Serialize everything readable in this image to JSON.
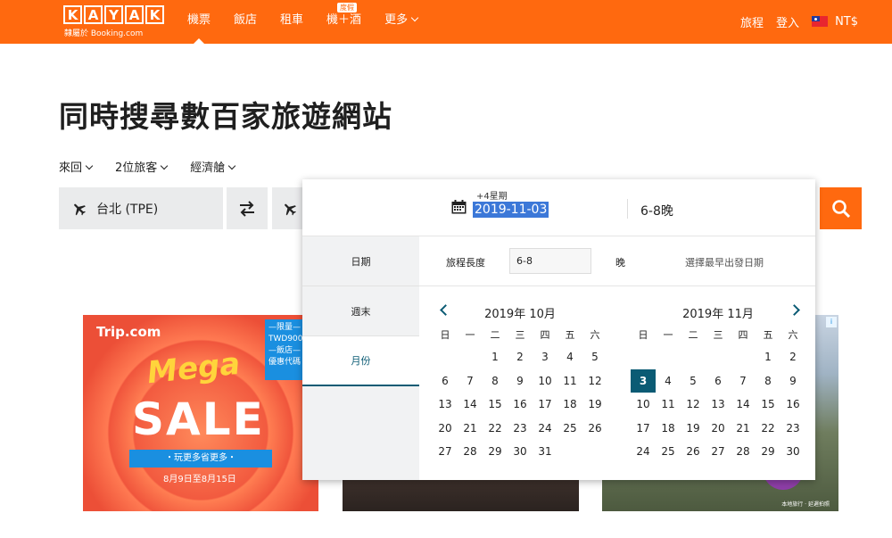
{
  "header": {
    "logo_letters": [
      "K",
      "A",
      "Y",
      "A",
      "K"
    ],
    "logo_sub": "隸屬於 Booking.com",
    "nav": [
      {
        "label": "機票",
        "active": true
      },
      {
        "label": "飯店"
      },
      {
        "label": "租車"
      },
      {
        "label": "機＋酒",
        "badge": "度假"
      },
      {
        "label": "更多"
      }
    ],
    "trips": "旅程",
    "login": "登入",
    "currency": "NT$"
  },
  "hero": {
    "title": "同時搜尋數百家旅遊網站",
    "options": [
      "來回",
      "2位旅客",
      "經濟艙"
    ]
  },
  "search": {
    "origin": "台北 (TPE)"
  },
  "datepicker": {
    "days_away": "+4星期",
    "date": "2019-11-03",
    "nights": "6-8晚",
    "tabs": [
      "日期",
      "週末",
      "月份"
    ],
    "active_tab": 2,
    "length_label": "旅程長度",
    "length_value": "6-8",
    "length_unit": "晚",
    "hint": "選擇最早出發日期",
    "weekdays": [
      "日",
      "一",
      "二",
      "三",
      "四",
      "五",
      "六"
    ],
    "months": [
      {
        "title": "2019年 10月",
        "offset": 2,
        "days": 31,
        "selected": null
      },
      {
        "title": "2019年 11月",
        "offset": 5,
        "days": 30,
        "selected": 3
      }
    ]
  },
  "ads": {
    "tripcom": {
      "brand": "Trip.com",
      "mega": "Mega",
      "sale": "SALE",
      "ribbon": "・玩更多省更多・",
      "dates": "8月9日至8月15日",
      "corner": "—限量—\nTWD900\n—飯店—\n優惠代碼"
    },
    "credit": "本地旅行 · 延遲拍照"
  },
  "colors": {
    "brand": "#ff690f",
    "accent": "#0b5b74",
    "selection": "#3c78d8"
  }
}
